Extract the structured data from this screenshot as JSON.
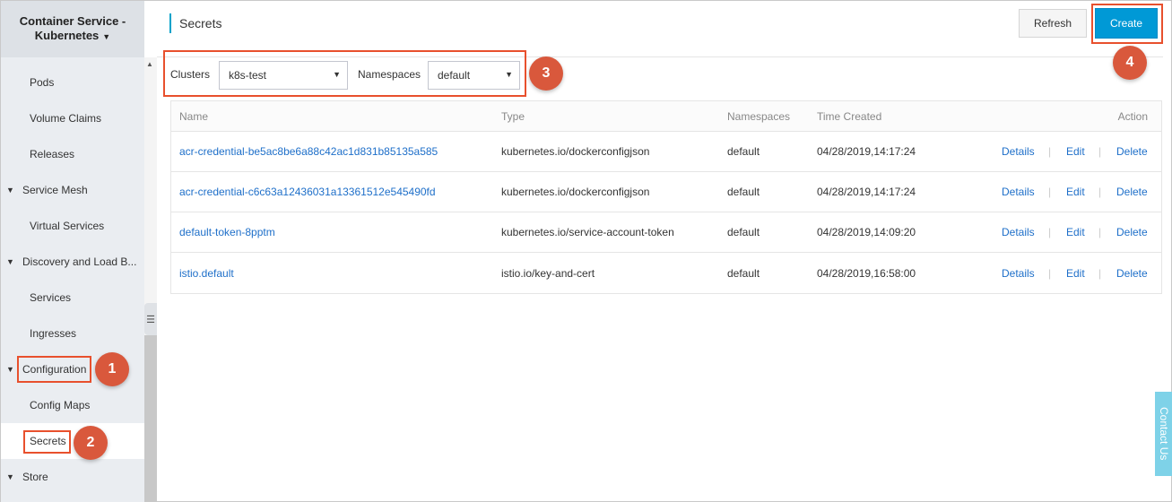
{
  "sidebar": {
    "title_line1": "Container Service -",
    "title_line2": "Kubernetes",
    "items": [
      {
        "label": "Pods"
      },
      {
        "label": "Volume Claims"
      },
      {
        "label": "Releases"
      },
      {
        "label": "Service Mesh"
      },
      {
        "label": "Virtual Services"
      },
      {
        "label": "Discovery and Load B..."
      },
      {
        "label": "Services"
      },
      {
        "label": "Ingresses"
      },
      {
        "label": "Configuration"
      },
      {
        "label": "Config Maps"
      },
      {
        "label": "Secrets"
      },
      {
        "label": "Store"
      }
    ]
  },
  "header": {
    "title": "Secrets",
    "refresh_label": "Refresh",
    "create_label": "Create"
  },
  "filters": {
    "clusters_label": "Clusters",
    "clusters_value": "k8s-test",
    "namespaces_label": "Namespaces",
    "namespaces_value": "default"
  },
  "table": {
    "columns": [
      "Name",
      "Type",
      "Namespaces",
      "Time Created",
      "Action"
    ],
    "rows": [
      {
        "name": "acr-credential-be5ac8be6a88c42ac1d831b85135a585",
        "type": "kubernetes.io/dockerconfigjson",
        "namespace": "default",
        "created": "04/28/2019,14:17:24"
      },
      {
        "name": "acr-credential-c6c63a12436031a13361512e545490fd",
        "type": "kubernetes.io/dockerconfigjson",
        "namespace": "default",
        "created": "04/28/2019,14:17:24"
      },
      {
        "name": "default-token-8pptm",
        "type": "kubernetes.io/service-account-token",
        "namespace": "default",
        "created": "04/28/2019,14:09:20"
      },
      {
        "name": "istio.default",
        "type": "istio.io/key-and-cert",
        "namespace": "default",
        "created": "04/28/2019,16:58:00"
      }
    ],
    "actions": {
      "details": "Details",
      "edit": "Edit",
      "delete": "Delete",
      "separator": "|"
    }
  },
  "annotations": [
    "1",
    "2",
    "3",
    "4"
  ],
  "contact_label": "Contact Us",
  "colors": {
    "accent": "#0099d6",
    "link": "#1e6fc9",
    "annotation": "#e8502d",
    "sidebar_bg": "#eaedf1"
  }
}
